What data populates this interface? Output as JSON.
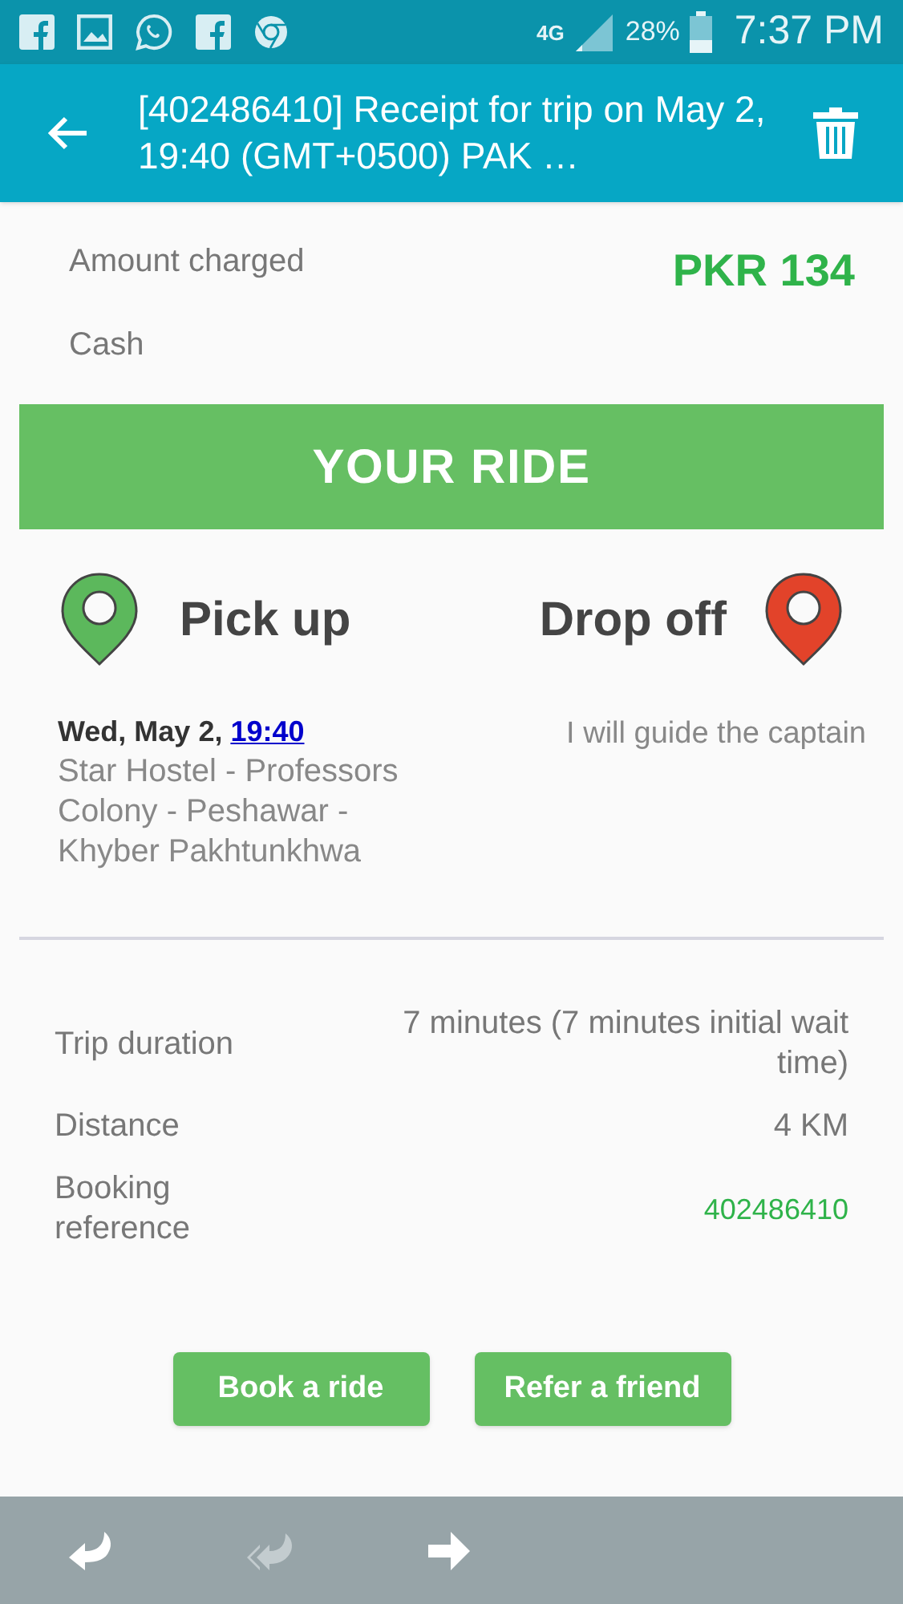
{
  "status_bar": {
    "network": "4G",
    "battery": "28%",
    "time": "7:37 PM"
  },
  "header": {
    "title": "[402486410] Receipt for trip on May 2, 19:40 (GMT+0500) PAK …"
  },
  "payment": {
    "label": "Amount charged",
    "amount": "PKR 134",
    "method": "Cash"
  },
  "banner": {
    "title": "YOUR RIDE"
  },
  "pickup": {
    "title": "Pick up",
    "date": "Wed, May 2, ",
    "time": "19:40",
    "address": "Star Hostel - Professors Colony - Peshawar - Khyber Pakhtunkhwa",
    "color": "#5cb85c"
  },
  "dropoff": {
    "title": "Drop off",
    "address": "I will guide the captain",
    "color": "#e2432a"
  },
  "details": [
    {
      "label": "Trip duration",
      "value": "7 minutes (7 minutes initial wait time)",
      "kind": "plain"
    },
    {
      "label": "Distance",
      "value": "4 KM",
      "kind": "plain"
    },
    {
      "label": "Booking reference",
      "value": "402486410",
      "kind": "accent"
    }
  ],
  "buttons": [
    "Book a ride",
    "Refer a friend"
  ],
  "bottom_bar": [
    {
      "kind": "reply",
      "disabled": false
    },
    {
      "kind": "reply-all",
      "disabled": true
    },
    {
      "kind": "forward",
      "disabled": false
    }
  ]
}
